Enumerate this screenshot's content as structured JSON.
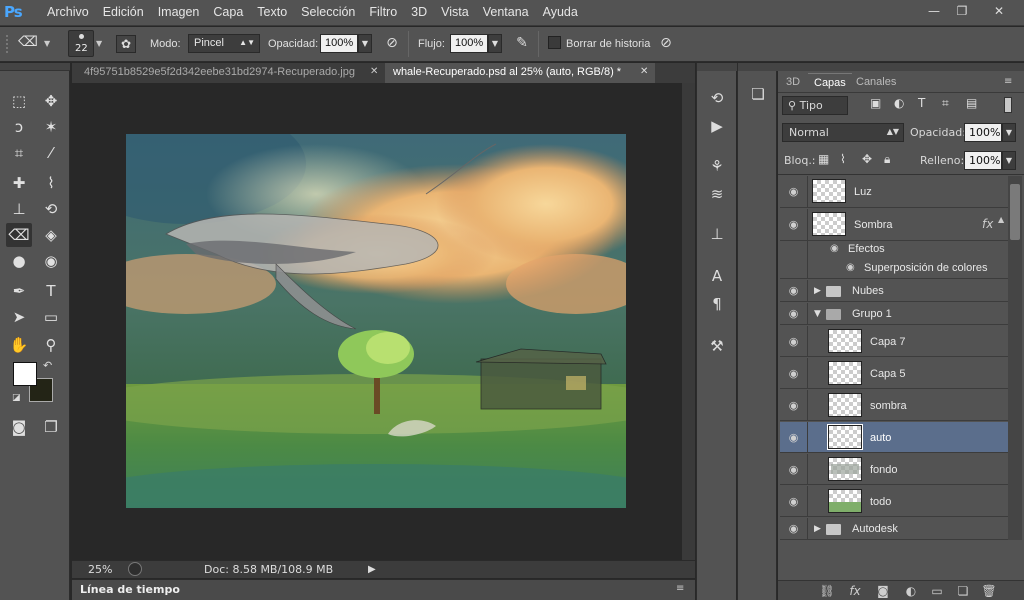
{
  "app": {
    "logo": "Ps"
  },
  "menu": [
    "Archivo",
    "Edición",
    "Imagen",
    "Capa",
    "Texto",
    "Selección",
    "Filtro",
    "3D",
    "Vista",
    "Ventana",
    "Ayuda"
  ],
  "window_controls": {
    "minimize": "—",
    "restore": "❐",
    "close": "✕"
  },
  "options": {
    "brush_size": "22",
    "mode_label": "Modo:",
    "mode_value": "Pincel",
    "opacity_label": "Opacidad:",
    "opacity_value": "100%",
    "flow_label": "Flujo:",
    "flow_value": "100%",
    "erase_history_label": "Borrar de historia"
  },
  "tabs": [
    {
      "label": "4f95751b8529e5f2d342eebe31bd2974-Recuperado.jpg",
      "active": false
    },
    {
      "label": "whale-Recuperado.psd al 25% (auto, RGB/8) *",
      "active": true
    }
  ],
  "status": {
    "zoom": "25%",
    "doc": "Doc: 8.58 MB/108.9 MB"
  },
  "timeline_label": "Línea de tiempo",
  "panel": {
    "tabs": [
      "3D",
      "Capas",
      "Canales"
    ],
    "active_tab": "Capas",
    "filter_kind": "Tipo",
    "blend_mode": "Normal",
    "opacity_label": "Opacidad:",
    "opacity_value": "100%",
    "lock_label": "Bloq.:",
    "fill_label": "Relleno:",
    "fill_value": "100%"
  },
  "layers": [
    {
      "name": "Luz",
      "kind": "layer",
      "indent": 0,
      "selected": false,
      "fx": false
    },
    {
      "name": "Sombra",
      "kind": "layer",
      "indent": 0,
      "selected": false,
      "fx": true
    },
    {
      "name": "Efectos",
      "kind": "effects-header",
      "indent": 1
    },
    {
      "name": "Superposición de colores",
      "kind": "effect",
      "indent": 2
    },
    {
      "name": "Nubes",
      "kind": "group",
      "indent": 0,
      "expanded": false
    },
    {
      "name": "Grupo 1",
      "kind": "group",
      "indent": 0,
      "expanded": true
    },
    {
      "name": "Capa 7",
      "kind": "layer",
      "indent": 1,
      "selected": false
    },
    {
      "name": "Capa 5",
      "kind": "layer",
      "indent": 1,
      "selected": false
    },
    {
      "name": "sombra",
      "kind": "layer",
      "indent": 1,
      "selected": false
    },
    {
      "name": "auto",
      "kind": "layer",
      "indent": 1,
      "selected": true
    },
    {
      "name": "fondo",
      "kind": "layer",
      "indent": 1,
      "selected": false
    },
    {
      "name": "todo",
      "kind": "layer",
      "indent": 1,
      "selected": false
    },
    {
      "name": "Autodesk",
      "kind": "group",
      "indent": 0,
      "expanded": false
    }
  ],
  "colors": {
    "accent": "#4aa7ff",
    "selected_row": "#5b6e8c",
    "panel_bg": "#535353"
  }
}
